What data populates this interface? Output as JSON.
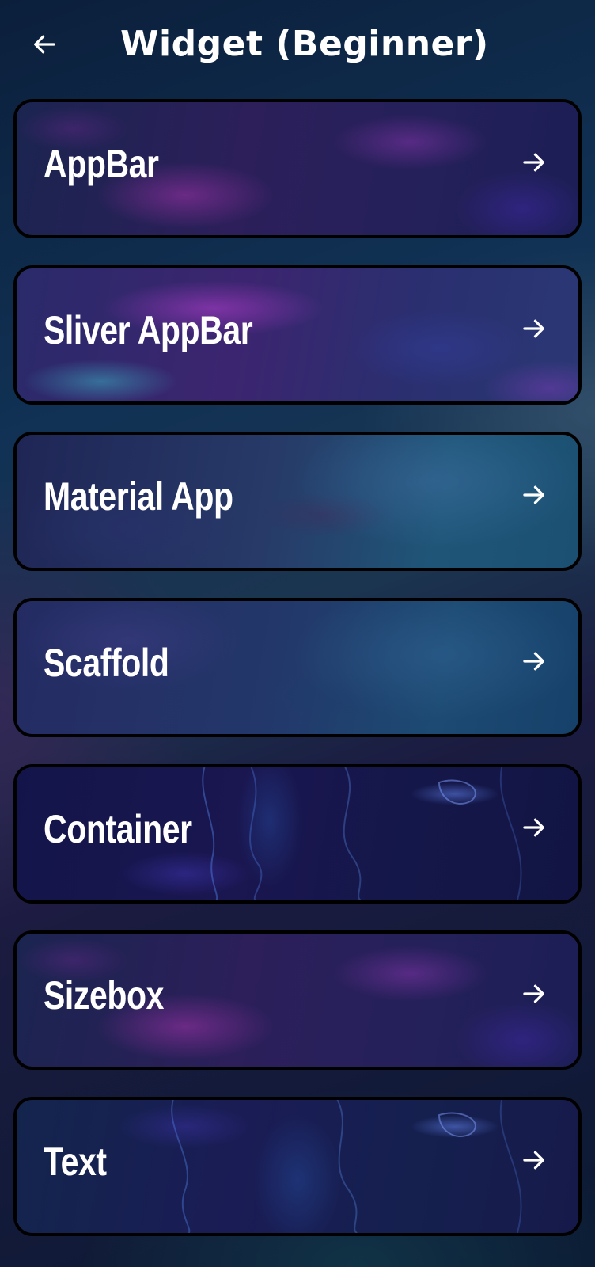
{
  "header": {
    "title": "Widget (Beginner)",
    "back_icon": "arrow-left-icon"
  },
  "items": [
    {
      "label": "AppBar",
      "icon": "arrow-right-icon",
      "theme": "bg-purple"
    },
    {
      "label": "Sliver AppBar",
      "icon": "arrow-right-icon",
      "theme": "bg-purple-teal"
    },
    {
      "label": "Material App",
      "icon": "arrow-right-icon",
      "theme": "bg-blue-marble"
    },
    {
      "label": "Scaffold",
      "icon": "arrow-right-icon",
      "theme": "bg-blue-marble2"
    },
    {
      "label": "Container",
      "icon": "arrow-right-icon",
      "theme": "bg-dark-wave"
    },
    {
      "label": "Sizebox",
      "icon": "arrow-right-icon",
      "theme": "bg-purple"
    },
    {
      "label": "Text",
      "icon": "arrow-right-icon",
      "theme": "bg-dark-wave2"
    }
  ],
  "colors": {
    "text": "#ffffff",
    "card_border": "#000000",
    "background": "#0b1f3b"
  }
}
